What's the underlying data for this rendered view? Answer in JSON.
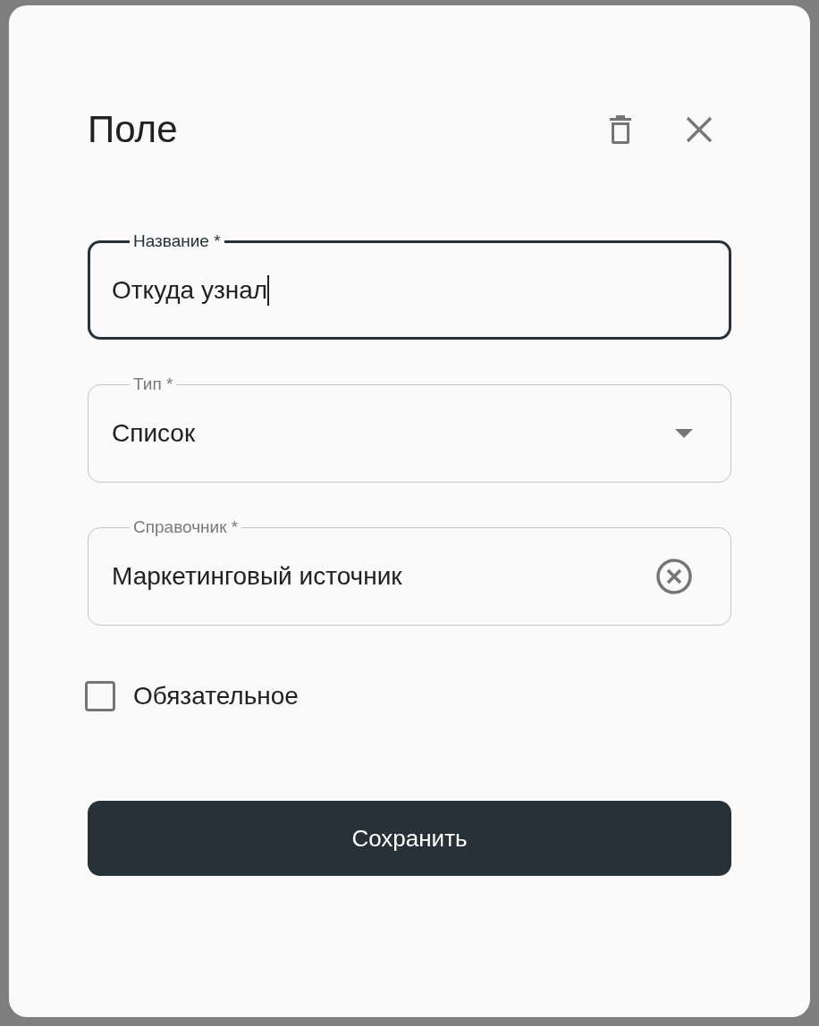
{
  "dialog": {
    "title": "Поле"
  },
  "fields": [
    {
      "kind": "text",
      "label": "Название *",
      "value": "Откуда узнал",
      "focused": true
    },
    {
      "kind": "select",
      "label": "Тип *",
      "value": "Список",
      "focused": false
    },
    {
      "kind": "autocomplete",
      "label": "Справочник *",
      "value": "Маркетинговый источник",
      "focused": false
    }
  ],
  "checkbox": {
    "label": "Обязательное",
    "checked": false
  },
  "save_button": "Сохранить"
}
